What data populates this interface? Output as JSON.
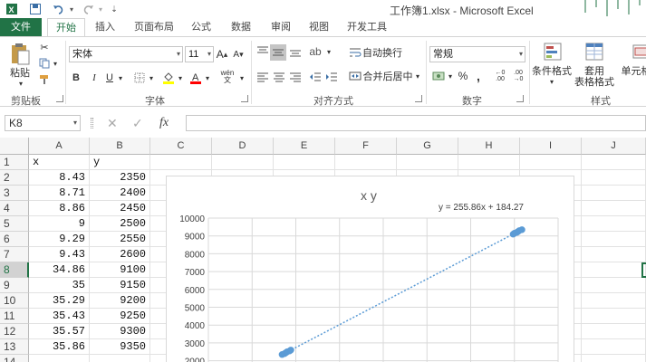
{
  "window": {
    "title": "工作簿1.xlsx - Microsoft Excel"
  },
  "quick_access": {
    "undo_icon": "undo-icon",
    "redo_icon": "redo-icon",
    "save_icon": "save-icon"
  },
  "tabs": [
    {
      "label": "文件"
    },
    {
      "label": "开始"
    },
    {
      "label": "插入"
    },
    {
      "label": "页面布局"
    },
    {
      "label": "公式"
    },
    {
      "label": "数据"
    },
    {
      "label": "审阅"
    },
    {
      "label": "视图"
    },
    {
      "label": "开发工具"
    }
  ],
  "ribbon": {
    "clipboard": {
      "paste": "粘贴",
      "group": "剪贴板"
    },
    "font": {
      "name": "宋体",
      "size": "11",
      "bold": "B",
      "italic": "I",
      "underline": "U",
      "grow": "A",
      "shrink": "A",
      "wen": "wén",
      "group": "字体"
    },
    "alignment": {
      "wrap": "自动换行",
      "merge": "合并后居中",
      "group": "对齐方式"
    },
    "number": {
      "format": "常规",
      "percent": "%",
      "comma": ",",
      "group": "数字"
    },
    "styles": {
      "conditional": "条件格式",
      "table_line1": "套用",
      "table_line2": "表格格式",
      "cell_line1": "单元格",
      "group": "样式"
    }
  },
  "formula_bar": {
    "name_box": "K8",
    "fx": "fx",
    "content": ""
  },
  "columns": [
    "A",
    "B",
    "C",
    "D",
    "E",
    "F",
    "G",
    "H",
    "I",
    "J"
  ],
  "rows": [
    "1",
    "2",
    "3",
    "4",
    "5",
    "6",
    "7",
    "8",
    "9",
    "10",
    "11",
    "12",
    "13",
    "14"
  ],
  "selected_row": "8",
  "table": {
    "header": {
      "a": "x",
      "b": "y"
    },
    "data": [
      [
        "8.43",
        "2350"
      ],
      [
        "8.71",
        "2400"
      ],
      [
        "8.86",
        "2450"
      ],
      [
        "9",
        "2500"
      ],
      [
        "9.29",
        "2550"
      ],
      [
        "9.43",
        "2600"
      ],
      [
        "34.86",
        "9100"
      ],
      [
        "35",
        "9150"
      ],
      [
        "35.29",
        "9200"
      ],
      [
        "35.43",
        "9250"
      ],
      [
        "35.57",
        "9300"
      ],
      [
        "35.86",
        "9350"
      ]
    ]
  },
  "chart_data": {
    "type": "scatter",
    "title": "x y",
    "trendline_label": "y = 255.86x + 184.27",
    "trendline": {
      "slope": 255.86,
      "intercept": 184.27
    },
    "x": [
      8.43,
      8.71,
      8.86,
      9,
      9.29,
      9.43,
      34.86,
      35,
      35.29,
      35.43,
      35.57,
      35.86
    ],
    "y": [
      2350,
      2400,
      2450,
      2500,
      2550,
      2600,
      9100,
      9150,
      9200,
      9250,
      9300,
      9350
    ],
    "yticks": [
      "10000",
      "9000",
      "8000",
      "7000",
      "6000",
      "5000",
      "4000",
      "3000",
      "2000"
    ],
    "ylim": [
      2000,
      10000
    ],
    "xlim": [
      0,
      40
    ],
    "grid": true,
    "colors": {
      "marker": "#5b9bd5",
      "trend": "#5b9bd5"
    }
  }
}
